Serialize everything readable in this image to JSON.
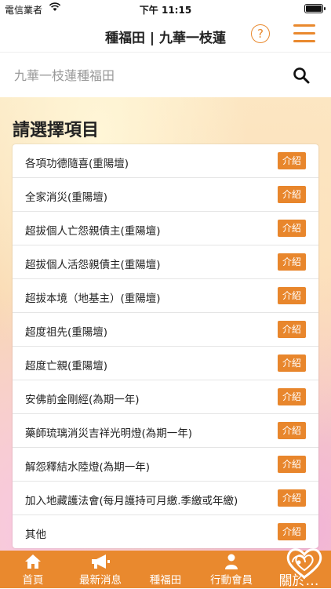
{
  "status_bar": {
    "carrier": "電信業者",
    "time": "下午 11:15"
  },
  "header": {
    "title": "種福田 | 九華一枝蓮"
  },
  "search": {
    "placeholder": "九華一枝蓮種福田"
  },
  "section": {
    "title": "請選擇項目"
  },
  "items": [
    {
      "label": "各項功德隨喜(重陽壇)",
      "button": "介紹"
    },
    {
      "label": "全家消災(重陽壇)",
      "button": "介紹"
    },
    {
      "label": "超拔個人亡怨親債主(重陽壇)",
      "button": "介紹"
    },
    {
      "label": "超拔個人活怨親債主(重陽壇)",
      "button": "介紹"
    },
    {
      "label": "超拔本境（地基主）(重陽壇)",
      "button": "介紹"
    },
    {
      "label": "超度祖先(重陽壇)",
      "button": "介紹"
    },
    {
      "label": "超度亡親(重陽壇)",
      "button": "介紹"
    },
    {
      "label": "安佛前金剛經(為期一年)",
      "button": "介紹"
    },
    {
      "label": "藥師琉璃消災吉祥光明燈(為期一年)",
      "button": "介紹"
    },
    {
      "label": "解怨釋結水陸燈(為期一年)",
      "button": "介紹"
    },
    {
      "label": "加入地藏護法會(每月護持可月繳.季繳或年繳)",
      "button": "介紹"
    },
    {
      "label": "其他",
      "button": "介紹"
    }
  ],
  "tabs": [
    {
      "label": "首頁",
      "icon": "home-icon"
    },
    {
      "label": "最新消息",
      "icon": "megaphone-icon"
    },
    {
      "label": "種福田",
      "icon": "heart-icon"
    },
    {
      "label": "行動會員",
      "icon": "person-icon"
    },
    {
      "label": "關於…",
      "icon": "info-icon"
    }
  ],
  "colors": {
    "accent": "#e9892e",
    "button": "#e8862c"
  }
}
